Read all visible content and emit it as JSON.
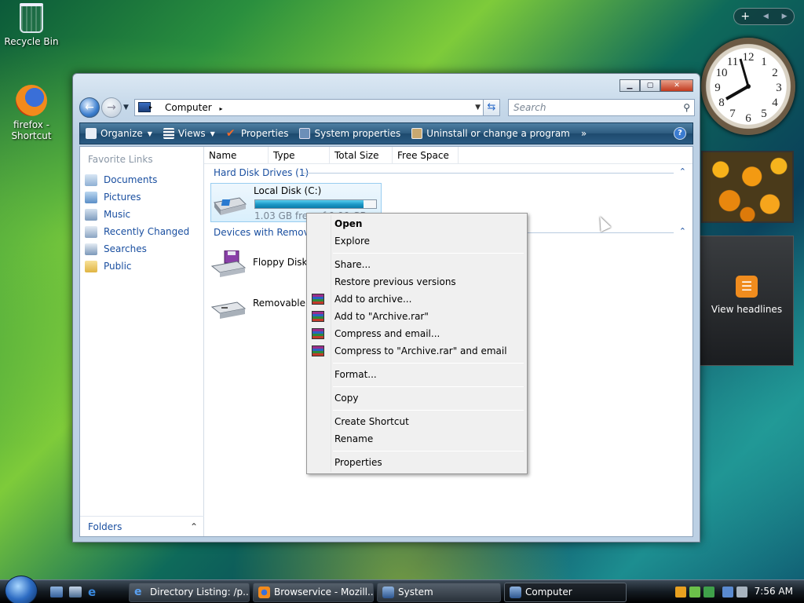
{
  "desktop": {
    "icons": [
      {
        "label": "Recycle Bin"
      },
      {
        "label": "firefox - Shortcut"
      }
    ]
  },
  "gadgets": {
    "toolbar": {
      "add": "+",
      "prev": "◀",
      "next": "▶"
    },
    "clock_numbers": [
      "12",
      "1",
      "2",
      "3",
      "4",
      "5",
      "6",
      "7",
      "8",
      "9",
      "10",
      "11"
    ],
    "rss_label": "View headlines"
  },
  "window": {
    "caption_buttons": {
      "minimize": "▁",
      "maximize": "▢",
      "close": "✕"
    },
    "address": {
      "path": "Computer",
      "sep1": "▸",
      "sep2": "▸"
    },
    "search_placeholder": "Search",
    "commands": [
      {
        "label": "Organize",
        "has_arrow": true
      },
      {
        "label": "Views",
        "has_arrow": true
      },
      {
        "label": "Properties"
      },
      {
        "label": "System properties"
      },
      {
        "label": "Uninstall or change a program"
      },
      {
        "label": "»"
      }
    ],
    "help": "?",
    "sidebar": {
      "title": "Favorite Links",
      "items": [
        "Documents",
        "Pictures",
        "Music",
        "Recently Changed",
        "Searches",
        "Public"
      ],
      "folders": "Folders",
      "folders_chevron": "⌃"
    },
    "columns": [
      "Name",
      "Type",
      "Total Size",
      "Free Space"
    ],
    "groups": [
      {
        "title": "Hard Disk Drives (1)",
        "chevron": "⌃"
      },
      {
        "title": "Devices with Removab",
        "chevron": "⌃"
      }
    ],
    "drives": [
      {
        "name": "Local Disk (C:)",
        "free_text": "1.03 GB free of 9.99 GB",
        "used_fraction": 0.897
      },
      {
        "name": "Floppy Disk D"
      },
      {
        "name": "Removable D"
      }
    ]
  },
  "context_menu": {
    "items": [
      {
        "label": "Open",
        "bold": true
      },
      {
        "label": "Explore"
      },
      {
        "label": "Share..."
      },
      {
        "label": "Restore previous versions"
      },
      {
        "label": "Add to archive...",
        "icon": "winrar-icon"
      },
      {
        "label": "Add to \"Archive.rar\"",
        "icon": "winrar-icon"
      },
      {
        "label": "Compress and email...",
        "icon": "winrar-icon"
      },
      {
        "label": "Compress to \"Archive.rar\" and email",
        "icon": "winrar-icon"
      },
      {
        "label": "Format..."
      },
      {
        "label": "Copy"
      },
      {
        "label": "Create Shortcut"
      },
      {
        "label": "Rename"
      },
      {
        "label": "Properties"
      }
    ]
  },
  "taskbar": {
    "buttons": [
      {
        "label": "Directory Listing: /p..."
      },
      {
        "label": "Browservice - Mozill..."
      },
      {
        "label": "System"
      },
      {
        "label": "Computer",
        "active": true
      }
    ],
    "time": "7:56 AM"
  },
  "colors": {
    "accent": "#1a4fa0",
    "command_bar": "#2d5b7f",
    "menu_bg": "#f0f0f0"
  }
}
